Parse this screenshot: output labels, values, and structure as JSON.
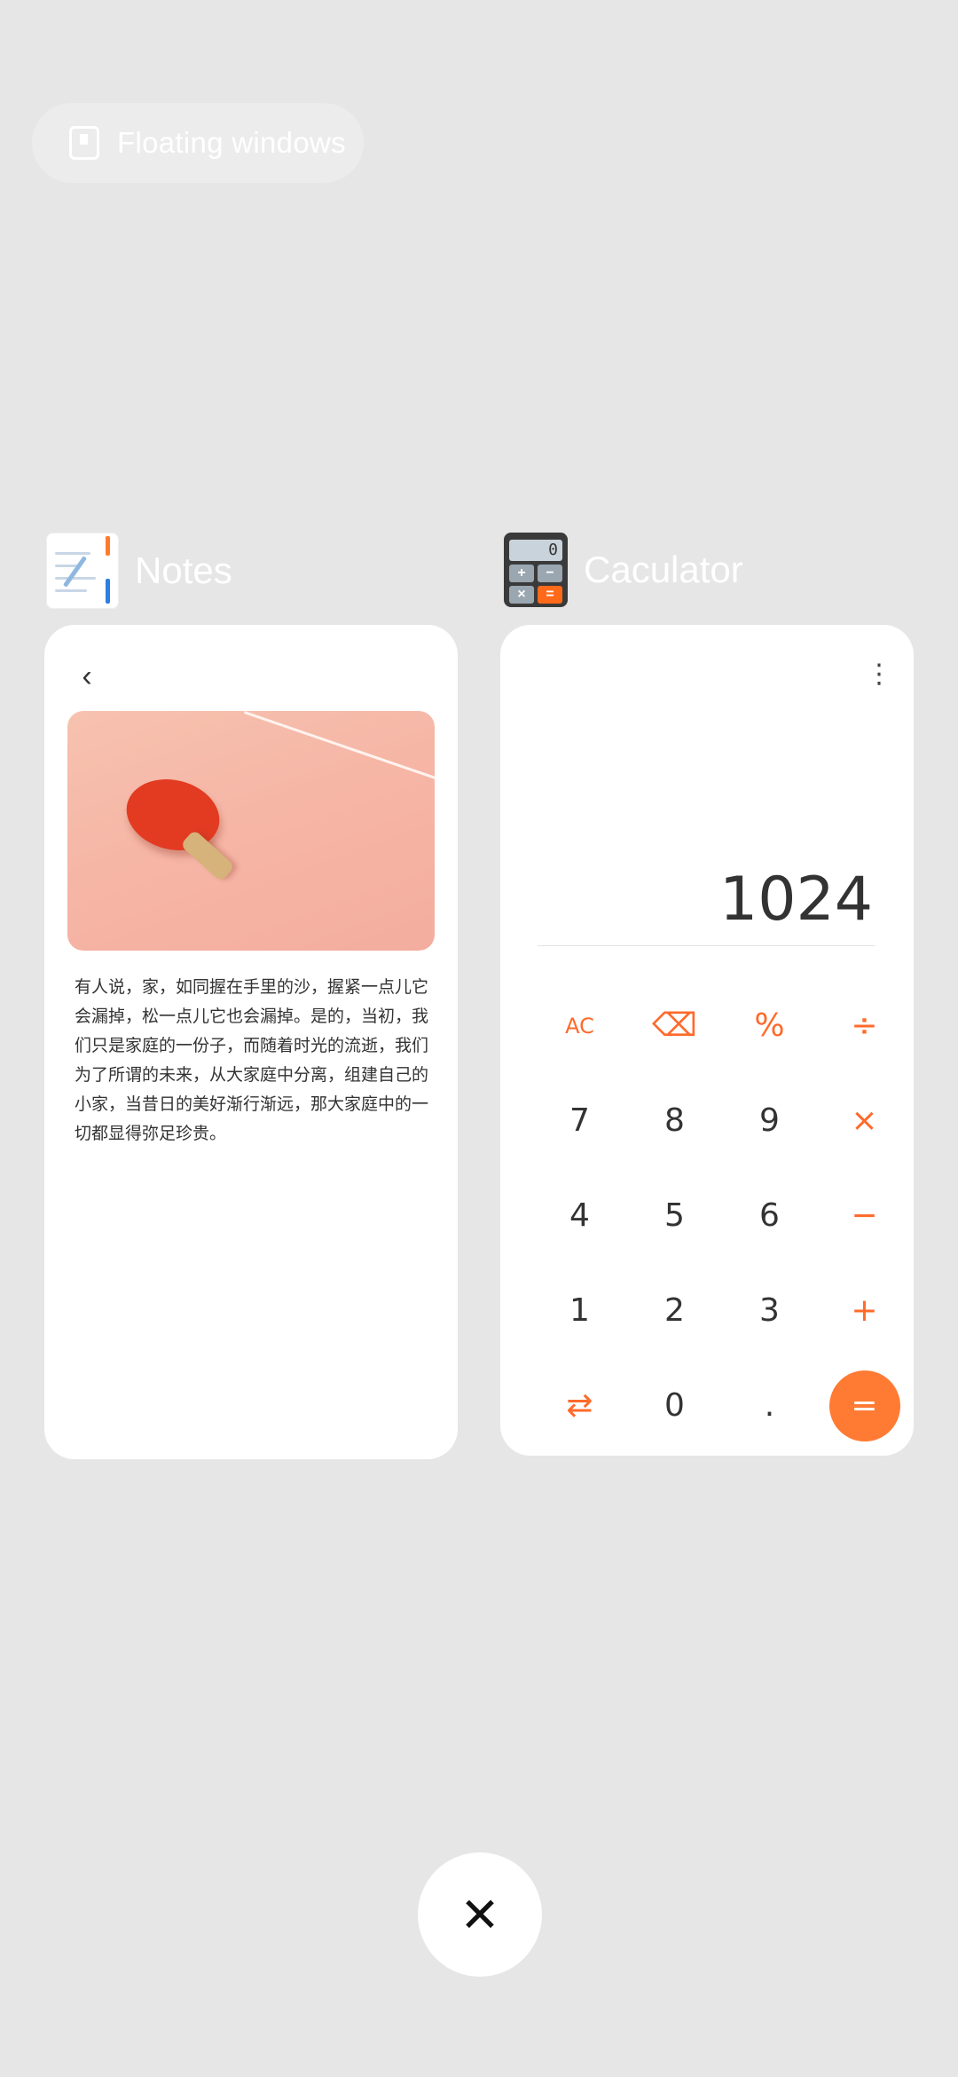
{
  "floating": {
    "label": "Floating windows",
    "icon": "floating-window-icon"
  },
  "notes_app": {
    "name": "Notes",
    "icon": "notes-app-icon",
    "back_glyph": "‹",
    "body_text": "有人说，家，如同握在手里的沙，握紧一点儿它会漏掉，松一点儿它也会漏掉。是的，当初，我们只是家庭的一份子，而随着时光的流逝，我们为了所谓的未来，从大家庭中分离，组建自己的小家，当昔日的美好渐行渐远，那大家庭中的一切都显得弥足珍贵。"
  },
  "calculator_app": {
    "name": "Caculator",
    "icon": "calculator-app-icon",
    "icon_screen": "0",
    "icon_keys": [
      "+",
      "−",
      "×",
      "="
    ],
    "more_glyph": "⋮",
    "display": "1024",
    "keys": [
      {
        "label": "AC",
        "type": "op"
      },
      {
        "label": "⌫",
        "type": "op"
      },
      {
        "label": "%",
        "type": "op"
      },
      {
        "label": "÷",
        "type": "op"
      },
      {
        "label": "7",
        "type": "num"
      },
      {
        "label": "8",
        "type": "num"
      },
      {
        "label": "9",
        "type": "num"
      },
      {
        "label": "×",
        "type": "op"
      },
      {
        "label": "4",
        "type": "num"
      },
      {
        "label": "5",
        "type": "num"
      },
      {
        "label": "6",
        "type": "num"
      },
      {
        "label": "−",
        "type": "op"
      },
      {
        "label": "1",
        "type": "num"
      },
      {
        "label": "2",
        "type": "num"
      },
      {
        "label": "3",
        "type": "num"
      },
      {
        "label": "+",
        "type": "op"
      },
      {
        "label": "⇄",
        "type": "op"
      },
      {
        "label": "0",
        "type": "num"
      },
      {
        "label": ".",
        "type": "num"
      },
      {
        "label": "=",
        "type": "eq"
      }
    ],
    "accent": "#ff7a33"
  },
  "close": {
    "glyph": "✕",
    "icon": "close-icon"
  },
  "colors": {
    "background": "#e6e6e6",
    "card": "#ffffff",
    "accent": "#ff6a2a"
  }
}
